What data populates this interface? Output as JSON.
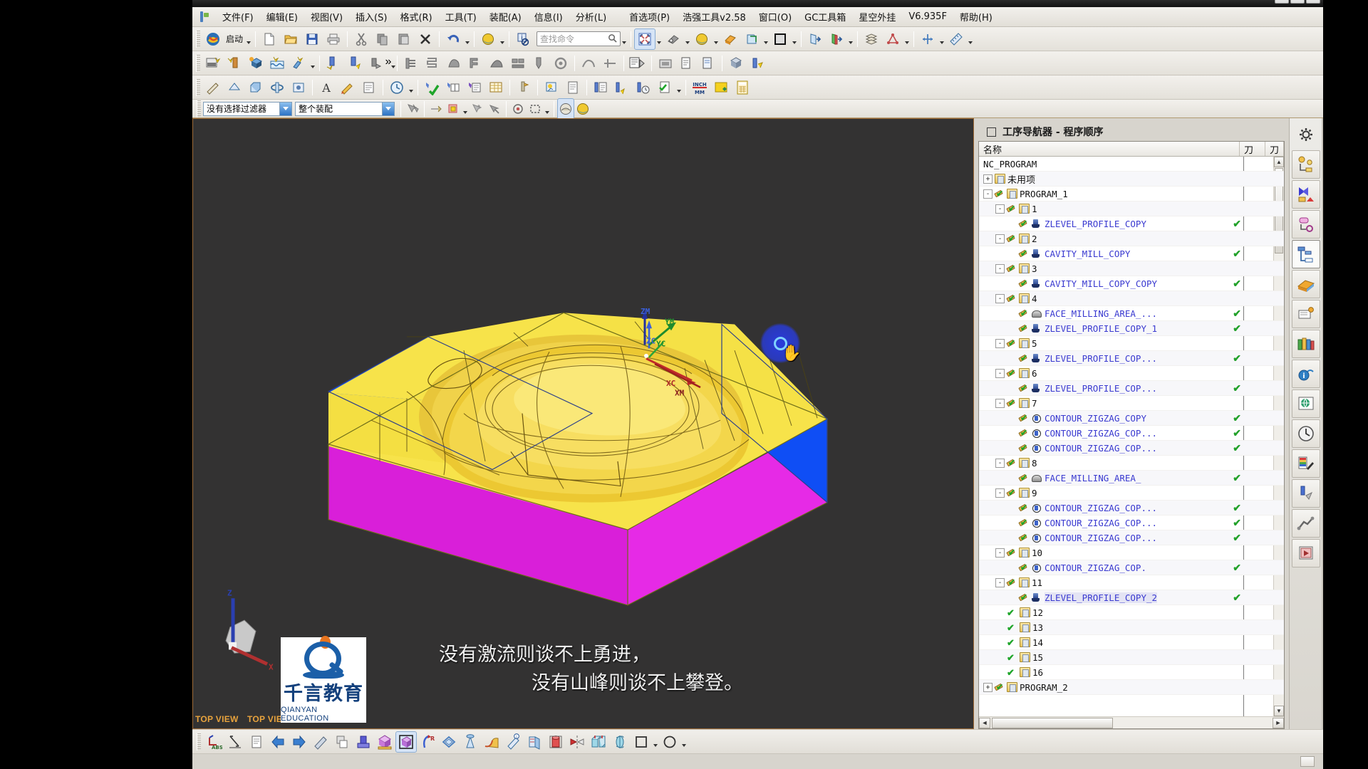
{
  "window": {
    "controls": [
      {
        "name": "minimize",
        "glyph": "—"
      },
      {
        "name": "restore",
        "glyph": "❐"
      },
      {
        "name": "close",
        "glyph": "✕"
      }
    ]
  },
  "menubar": {
    "items": [
      {
        "label": "文件(F)"
      },
      {
        "label": "编辑(E)"
      },
      {
        "label": "视图(V)"
      },
      {
        "label": "插入(S)"
      },
      {
        "label": "格式(R)"
      },
      {
        "label": "工具(T)"
      },
      {
        "label": "装配(A)"
      },
      {
        "label": "信息(I)"
      },
      {
        "label": "分析(L)"
      },
      {
        "label": "首选项(P)"
      },
      {
        "label": "浩强工具v2.58"
      },
      {
        "label": "窗口(O)"
      },
      {
        "label": "GC工具箱"
      },
      {
        "label": "星空外挂"
      },
      {
        "label": "V6.935F"
      },
      {
        "label": "帮助(H)"
      }
    ]
  },
  "toolbar_row1": {
    "start_label": "启动",
    "find_placeholder": "查找命令"
  },
  "filterbar": {
    "filter_value": "没有选择过滤器",
    "scope_value": "整个装配"
  },
  "navigator": {
    "title": "工序导航器 - 程序顺序",
    "columns": [
      "名称",
      "刀",
      "刀"
    ],
    "rows": [
      {
        "depth": 0,
        "kind": "root",
        "label": "NC_PROGRAM",
        "pm": "",
        "check": false
      },
      {
        "depth": 0,
        "kind": "folder",
        "label": "未用项",
        "pm": "+",
        "check": false,
        "cjk": true
      },
      {
        "depth": 0,
        "kind": "folder-green",
        "label": "PROGRAM_1",
        "pm": "-",
        "check": false
      },
      {
        "depth": 1,
        "kind": "folder-green",
        "label": "1",
        "pm": "-",
        "check": false
      },
      {
        "depth": 2,
        "kind": "op-zlevel",
        "label": "ZLEVEL_PROFILE_COPY",
        "pm": "",
        "check": true
      },
      {
        "depth": 1,
        "kind": "folder-green",
        "label": "2",
        "pm": "-",
        "check": false
      },
      {
        "depth": 2,
        "kind": "op-zlevel",
        "label": "CAVITY_MILL_COPY",
        "pm": "",
        "check": true
      },
      {
        "depth": 1,
        "kind": "folder-green",
        "label": "3",
        "pm": "-",
        "check": false
      },
      {
        "depth": 2,
        "kind": "op-zlevel",
        "label": "CAVITY_MILL_COPY_COPY",
        "pm": "",
        "check": true
      },
      {
        "depth": 1,
        "kind": "folder-green",
        "label": "4",
        "pm": "-",
        "check": false
      },
      {
        "depth": 2,
        "kind": "op-face",
        "label": "FACE_MILLING_AREA_...",
        "pm": "",
        "check": true
      },
      {
        "depth": 2,
        "kind": "op-zlevel",
        "label": "ZLEVEL_PROFILE_COPY_1",
        "pm": "",
        "check": true
      },
      {
        "depth": 1,
        "kind": "folder-green",
        "label": "5",
        "pm": "-",
        "check": false
      },
      {
        "depth": 2,
        "kind": "op-zlevel",
        "label": "ZLEVEL_PROFILE_COP...",
        "pm": "",
        "check": true
      },
      {
        "depth": 1,
        "kind": "folder-green",
        "label": "6",
        "pm": "-",
        "check": false
      },
      {
        "depth": 2,
        "kind": "op-zlevel",
        "label": "ZLEVEL_PROFILE_COP...",
        "pm": "",
        "check": true
      },
      {
        "depth": 1,
        "kind": "folder-green",
        "label": "7",
        "pm": "-",
        "check": false
      },
      {
        "depth": 2,
        "kind": "op-contour",
        "label": "CONTOUR_ZIGZAG_COPY",
        "pm": "",
        "check": true
      },
      {
        "depth": 2,
        "kind": "op-contour",
        "label": "CONTOUR_ZIGZAG_COP...",
        "pm": "",
        "check": true
      },
      {
        "depth": 2,
        "kind": "op-contour",
        "label": "CONTOUR_ZIGZAG_COP...",
        "pm": "",
        "check": true
      },
      {
        "depth": 1,
        "kind": "folder-green",
        "label": "8",
        "pm": "-",
        "check": false
      },
      {
        "depth": 2,
        "kind": "op-face",
        "label": "FACE_MILLING_AREA_",
        "pm": "",
        "check": true
      },
      {
        "depth": 1,
        "kind": "folder-green",
        "label": "9",
        "pm": "-",
        "check": false
      },
      {
        "depth": 2,
        "kind": "op-contour",
        "label": "CONTOUR_ZIGZAG_COP...",
        "pm": "",
        "check": true
      },
      {
        "depth": 2,
        "kind": "op-contour",
        "label": "CONTOUR_ZIGZAG_COP...",
        "pm": "",
        "check": true
      },
      {
        "depth": 2,
        "kind": "op-contour",
        "label": "CONTOUR_ZIGZAG_COP...",
        "pm": "",
        "check": true
      },
      {
        "depth": 1,
        "kind": "folder-green",
        "label": "10",
        "pm": "-",
        "check": false
      },
      {
        "depth": 2,
        "kind": "op-contour",
        "label": "CONTOUR_ZIGZAG_COP.",
        "pm": "",
        "check": true
      },
      {
        "depth": 1,
        "kind": "folder-green",
        "label": "11",
        "pm": "-",
        "check": false
      },
      {
        "depth": 2,
        "kind": "op-zlevel",
        "label": "ZLEVEL_PROFILE_COPY_2",
        "pm": "",
        "check": true,
        "selected": true
      },
      {
        "depth": 1,
        "kind": "folder-check",
        "label": "12",
        "pm": "",
        "check": false
      },
      {
        "depth": 1,
        "kind": "folder-check",
        "label": "13",
        "pm": "",
        "check": false
      },
      {
        "depth": 1,
        "kind": "folder-check",
        "label": "14",
        "pm": "",
        "check": false
      },
      {
        "depth": 1,
        "kind": "folder-check",
        "label": "15",
        "pm": "",
        "check": false
      },
      {
        "depth": 1,
        "kind": "folder-check",
        "label": "16",
        "pm": "",
        "check": false
      },
      {
        "depth": 0,
        "kind": "folder-dim",
        "label": "PROGRAM_2",
        "pm": "+",
        "check": false
      }
    ]
  },
  "viewport": {
    "axis_labels": [
      {
        "text": "ZM",
        "color": "#3a5fd9"
      },
      {
        "text": "YM",
        "color": "#1f8b2e"
      },
      {
        "text": "ZC",
        "color": "#3a5fd9"
      },
      {
        "text": "YC",
        "color": "#1f8b2e"
      },
      {
        "text": "XC",
        "color": "#b02a2a"
      },
      {
        "text": "XM",
        "color": "#b02a2a"
      }
    ],
    "view_labels": [
      "TOP VIEW",
      "TOP VIEW"
    ],
    "background_color": "#333232",
    "colors": {
      "stock_yellow": "#f5dd3c",
      "stock_blue": "#1352f0",
      "stock_magenta": "#e41ae4",
      "part_gold": "#e0b02a"
    }
  },
  "watermark": {
    "logo_letter": "Q",
    "cn_name": "千言教育",
    "en_name": "QIANYAN EDUCATION"
  },
  "subtitle": {
    "line1": "没有激流则谈不上勇进，",
    "line2": "没有山峰则谈不上攀登。"
  }
}
